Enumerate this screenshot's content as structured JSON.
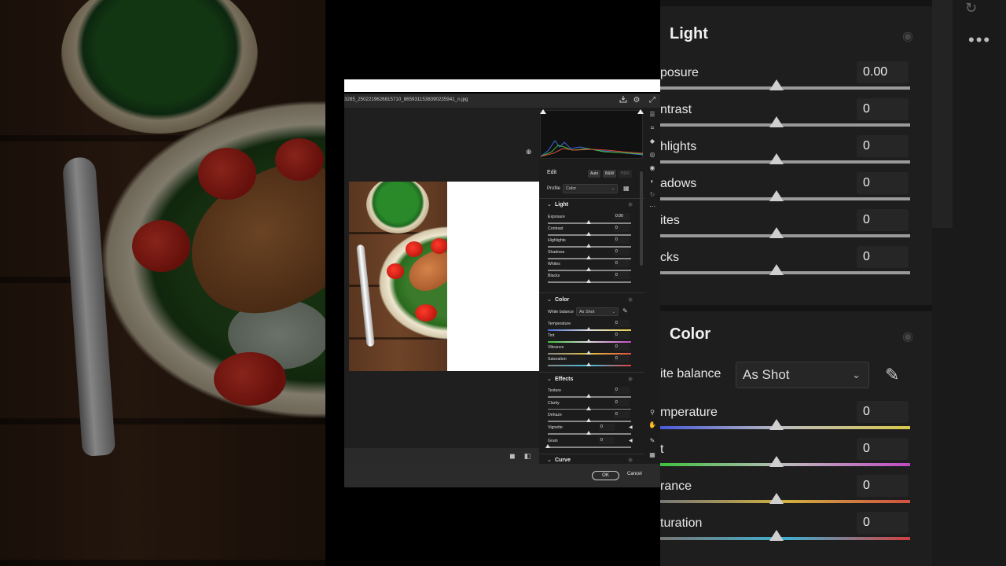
{
  "file": {
    "name": "3285_2502219626815710_8659311538390235941_n.jpg"
  },
  "edit": {
    "title": "Edit",
    "buttons": {
      "auto": "Auto",
      "bw": "B&W",
      "hdr": "HDR"
    },
    "profile": {
      "label": "Profile",
      "value": "Color"
    }
  },
  "light": {
    "title": "Light",
    "sliders": [
      {
        "label": "Exposure",
        "value": "0.00"
      },
      {
        "label": "Contrast",
        "value": "0"
      },
      {
        "label": "Highlights",
        "value": "0"
      },
      {
        "label": "Shadows",
        "value": "0"
      },
      {
        "label": "Whites",
        "value": "0"
      },
      {
        "label": "Blacks",
        "value": "0"
      }
    ]
  },
  "color": {
    "title": "Color",
    "white_balance": {
      "label": "White balance",
      "value": "As Shot"
    },
    "sliders": [
      {
        "label": "Temperature",
        "value": "0"
      },
      {
        "label": "Tint",
        "value": "0"
      },
      {
        "label": "Vibrance",
        "value": "0"
      },
      {
        "label": "Saturation",
        "value": "0"
      }
    ]
  },
  "effects": {
    "title": "Effects",
    "sliders": [
      {
        "label": "Texture",
        "value": "0"
      },
      {
        "label": "Clarity",
        "value": "0"
      },
      {
        "label": "Dehaze",
        "value": "0"
      },
      {
        "label": "Vignette",
        "value": "0"
      },
      {
        "label": "Grain",
        "value": "0"
      }
    ]
  },
  "curve": {
    "title": "Curve"
  },
  "footer": {
    "ok": "OK",
    "cancel": "Cancel"
  },
  "zoom": {
    "light_title": "Light",
    "color_title": "Color",
    "light_rows": [
      {
        "label": "posure",
        "value": "0.00"
      },
      {
        "label": "ntrast",
        "value": "0"
      },
      {
        "label": "hlights",
        "value": "0"
      },
      {
        "label": "adows",
        "value": "0"
      },
      {
        "label": "ites",
        "value": "0"
      },
      {
        "label": "cks",
        "value": "0"
      }
    ],
    "wb_label": "ite balance",
    "wb_value": "As Shot",
    "color_rows": [
      {
        "label": "mperature",
        "value": "0"
      },
      {
        "label": "t",
        "value": "0"
      },
      {
        "label": "rance",
        "value": "0"
      },
      {
        "label": "turation",
        "value": "0"
      }
    ]
  },
  "colors": {
    "accent": "#ffffff",
    "panel": "#1c1c1c",
    "bar": "#2a2a2a"
  }
}
